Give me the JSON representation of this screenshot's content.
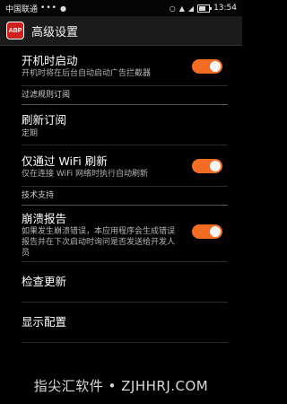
{
  "status_bar": {
    "carrier": "中国联通",
    "dots": "•••",
    "time": "13:54"
  },
  "action_bar": {
    "logo_text": "ABP",
    "title": "高级设置"
  },
  "accent_color": "#f26c23",
  "prefs": {
    "autostart": {
      "title": "开机时启动",
      "summary": "开机时将在后台自动启动广告拦截器",
      "enabled": true
    },
    "category_filter": "过滤规则订阅",
    "refresh": {
      "title": "刷新订阅",
      "summary": "定期"
    },
    "wifi_only": {
      "title": "仅通过 WiFi 刷新",
      "summary": "仅在连接 WiFi 网络时执行自动刷新",
      "enabled": true
    },
    "category_support": "技术支持",
    "crash": {
      "title": "崩溃报告",
      "summary": "如果发生崩溃错误，本应用程序会生成错误报告并在下次启动时询问是否发送给开发人员",
      "enabled": true
    },
    "check_update": {
      "title": "检查更新"
    },
    "show_config": {
      "title": "显示配置"
    }
  },
  "watermark": "指尖汇软件 • ZJHHRJ.COM"
}
